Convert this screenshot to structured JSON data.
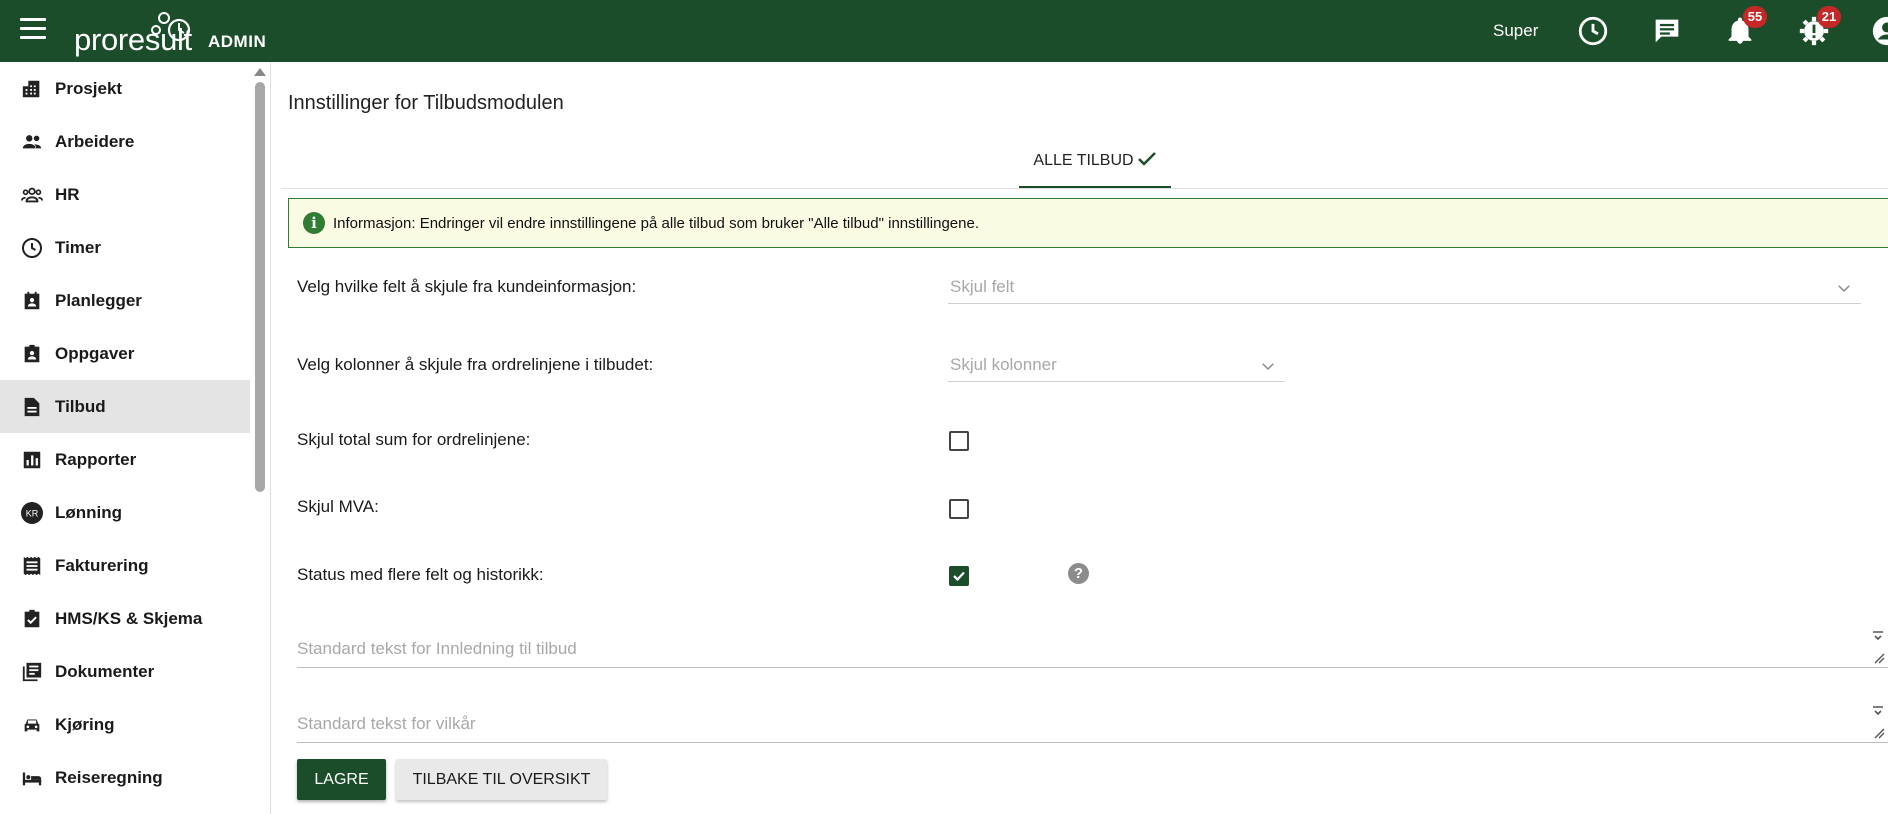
{
  "topbar": {
    "logo_text": "proresult",
    "logo_sub": "ADMIN",
    "user_name": "Super",
    "notifications_count": "55",
    "alerts_count": "21",
    "icons": [
      "menu-icon",
      "clock-icon",
      "chat-icon",
      "bell-icon",
      "alert-gear-icon",
      "account-icon"
    ]
  },
  "sidebar": {
    "items": [
      {
        "label": "Prosjekt",
        "icon": "building-icon"
      },
      {
        "label": "Arbeidere",
        "icon": "people-icon"
      },
      {
        "label": "HR",
        "icon": "group-icon"
      },
      {
        "label": "Timer",
        "icon": "clock-icon"
      },
      {
        "label": "Planlegger",
        "icon": "planner-icon"
      },
      {
        "label": "Oppgaver",
        "icon": "assignment-icon"
      },
      {
        "label": "Tilbud",
        "icon": "document-icon",
        "active": true
      },
      {
        "label": "Rapporter",
        "icon": "chart-icon"
      },
      {
        "label": "Lønning",
        "icon": "kr-icon",
        "icon_text": "KR"
      },
      {
        "label": "Fakturering",
        "icon": "receipt-icon"
      },
      {
        "label": "HMS/KS & Skjema",
        "icon": "checklist-icon"
      },
      {
        "label": "Dokumenter",
        "icon": "library-icon"
      },
      {
        "label": "Kjøring",
        "icon": "car-icon"
      },
      {
        "label": "Reiseregning",
        "icon": "bed-icon"
      }
    ]
  },
  "main": {
    "title": "Innstillinger for Tilbudsmodulen",
    "tab_label": "ALLE TILBUD",
    "info_text": "Informasjon: Endringer vil endre innstillingene på alle tilbud som bruker \"Alle tilbud\" innstillingene.",
    "fields": {
      "hide_fields_label": "Velg hvilke felt å skjule fra kundeinformasjon:",
      "hide_fields_placeholder": "Skjul felt",
      "hide_columns_label": "Velg kolonner å skjule fra ordrelinjene i tilbudet:",
      "hide_columns_placeholder": "Skjul kolonner",
      "hide_total_label": "Skjul total sum for ordrelinjene:",
      "hide_total_checked": false,
      "hide_vat_label": "Skjul MVA:",
      "hide_vat_checked": false,
      "status_label": "Status med flere felt og historikk:",
      "status_checked": true,
      "intro_placeholder": "Standard tekst for Innledning til tilbud",
      "terms_placeholder": "Standard tekst for vilkår"
    },
    "buttons": {
      "save": "LAGRE",
      "back": "TILBAKE TIL OVERSIKT"
    }
  },
  "colors": {
    "brand": "#1b4d2b",
    "badge": "#c62828",
    "info_bg": "#fafbe3",
    "info_border": "#2e7d32"
  }
}
